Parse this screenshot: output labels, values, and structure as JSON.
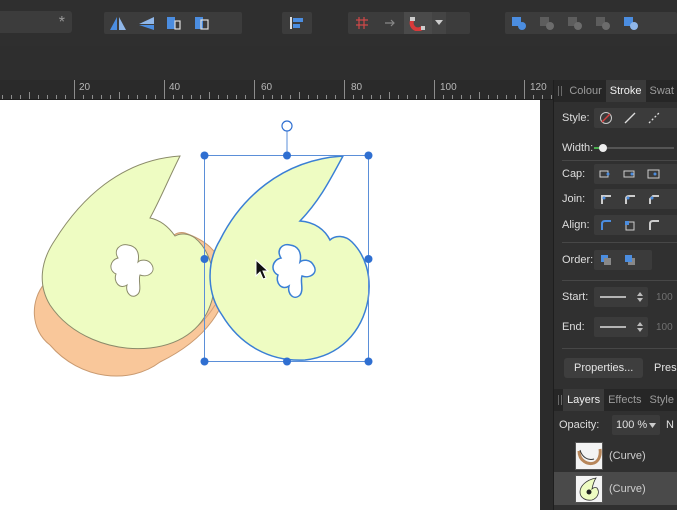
{
  "toolbar": {
    "field_value": "*",
    "icons": [
      "flip-horizontal-icon",
      "flip-vertical-icon",
      "rotate-left-icon",
      "rotate-right-icon",
      "align-left-icon",
      "grid-icon",
      "arrow-icon",
      "snap-magnet-icon",
      "boolean-add-icon",
      "boolean-subtract-icon",
      "boolean-intersect-icon",
      "boolean-xor-icon",
      "boolean-divide-icon"
    ]
  },
  "ruler": {
    "labels": [
      "20",
      "40",
      "60",
      "80",
      "100",
      "120"
    ]
  },
  "panel": {
    "tabs": [
      "Colour",
      "Stroke",
      "Swat"
    ],
    "active_tab": "Stroke",
    "style_label": "Style:",
    "width_label": "Width:",
    "cap_label": "Cap:",
    "join_label": "Join:",
    "align_label": "Align:",
    "order_label": "Order:",
    "start_label": "Start:",
    "end_label": "End:",
    "start_value": "100",
    "end_value": "100",
    "properties_button": "Properties...",
    "pressure_button": "Pres"
  },
  "layers": {
    "tabs": [
      "Layers",
      "Effects",
      "Style"
    ],
    "active_tab": "Layers",
    "opacity_label": "Opacity:",
    "opacity_value": "100 %",
    "blend_value": "N",
    "items": [
      {
        "name": "(Curve)",
        "selected": false
      },
      {
        "name": "(Curve)",
        "selected": true
      }
    ]
  },
  "colors": {
    "accent": "#3a7fd5",
    "selection": "#2f6fd1",
    "shape_fill": "#eefcc2",
    "shadow_fill": "#f9c79a"
  }
}
